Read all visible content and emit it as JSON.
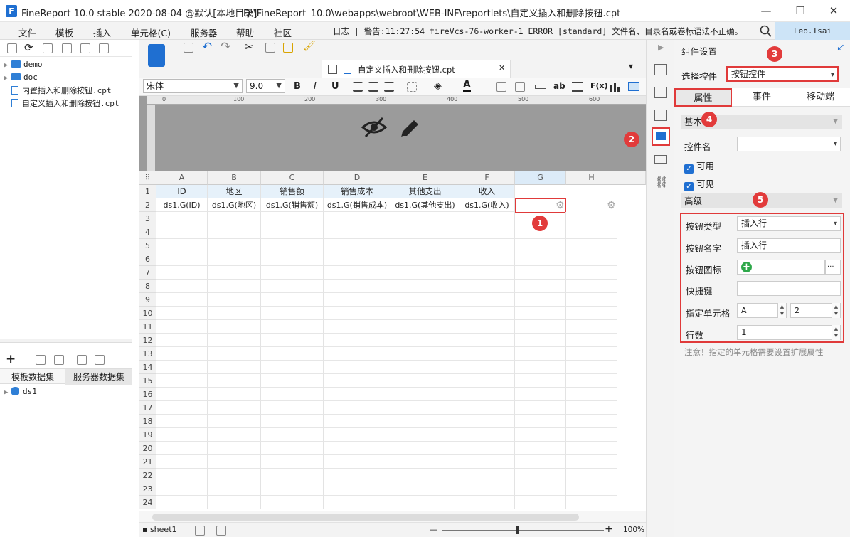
{
  "title": {
    "app": "FineReport 10.0 stable 2020-08-04 @默认[本地目录]",
    "path": "D:\\FineReport_10.0\\webapps\\webroot\\WEB-INF\\reportlets\\自定义插入和删除按钮.cpt",
    "logo": "F"
  },
  "window_buttons": {
    "min": "—",
    "max": "☐",
    "close": "✕"
  },
  "menu": [
    "文件",
    "模板",
    "插入",
    "单元格(C)",
    "服务器",
    "帮助",
    "社区"
  ],
  "log_message": "日志 | 警告:11:27:54 fireVcs-76-worker-1 ERROR [standard] 文件名、目录名或卷标语法不正确。",
  "user": "Leo.Tsai",
  "tree": [
    {
      "label": "demo"
    },
    {
      "label": "doc"
    },
    {
      "label": "内置插入和删除按钮.cpt"
    },
    {
      "label": "自定义插入和删除按钮.cpt"
    }
  ],
  "dataset_tabs": [
    "模板数据集",
    "服务器数据集"
  ],
  "dataset_item": "ds1",
  "doc_tab": "自定义插入和删除按钮.cpt",
  "doc_tab_close": "✕",
  "format": {
    "font": "宋体",
    "size": "9.0",
    "bold": "B",
    "italic": "I",
    "underline": "U",
    "text_btn": "ab",
    "fx": "F(x)"
  },
  "ruler_ticks": [
    "0",
    "100",
    "200",
    "300",
    "400",
    "500",
    "600"
  ],
  "columns": [
    "A",
    "B",
    "C",
    "D",
    "E",
    "F",
    "G",
    "H"
  ],
  "rows": [
    "1",
    "2",
    "3",
    "4",
    "5",
    "6",
    "7",
    "8",
    "9",
    "10",
    "11",
    "12",
    "13",
    "14",
    "15",
    "16",
    "17",
    "18",
    "19",
    "20",
    "21",
    "22",
    "23",
    "24"
  ],
  "header_cells": [
    "ID",
    "地区",
    "销售额",
    "销售成本",
    "其他支出",
    "收入"
  ],
  "data_cells": [
    "ds1.G(ID)",
    "ds1.G(地区)",
    "ds1.G(销售额)",
    "ds1.G(销售成本)",
    "ds1.G(其他支出)",
    "ds1.G(收入)"
  ],
  "sheet": "sheet1",
  "zoom": "100%",
  "zoom_minus": "—",
  "zoom_plus": "+",
  "right": {
    "title": "组件设置",
    "select_label": "选择控件",
    "select_value": "按钮控件",
    "tabs": [
      "属性",
      "事件",
      "移动端"
    ],
    "section_basic": "基本",
    "name_label": "控件名",
    "name_value": "",
    "enabled_label": "可用",
    "visible_label": "可见",
    "section_advanced": "高级",
    "btn_type_label": "按钮类型",
    "btn_type_value": "插入行",
    "btn_name_label": "按钮名字",
    "btn_name_value": "插入行",
    "btn_icon_label": "按钮图标",
    "btn_icon_more": "···",
    "hotkey_label": "快捷键",
    "hotkey_value": "",
    "cell_label": "指定单元格",
    "cell_col": "A",
    "cell_row": "2",
    "rows_label": "行数",
    "rows_value": "1",
    "note": "注意！指定的单元格需要设置扩展属性"
  },
  "badges": [
    "1",
    "2",
    "3",
    "4",
    "5"
  ],
  "colors": {
    "accent": "#1f6fd1",
    "badge": "#e23b3b",
    "header_cell": "#e6f1fa",
    "user_bg": "#cde4f7"
  }
}
